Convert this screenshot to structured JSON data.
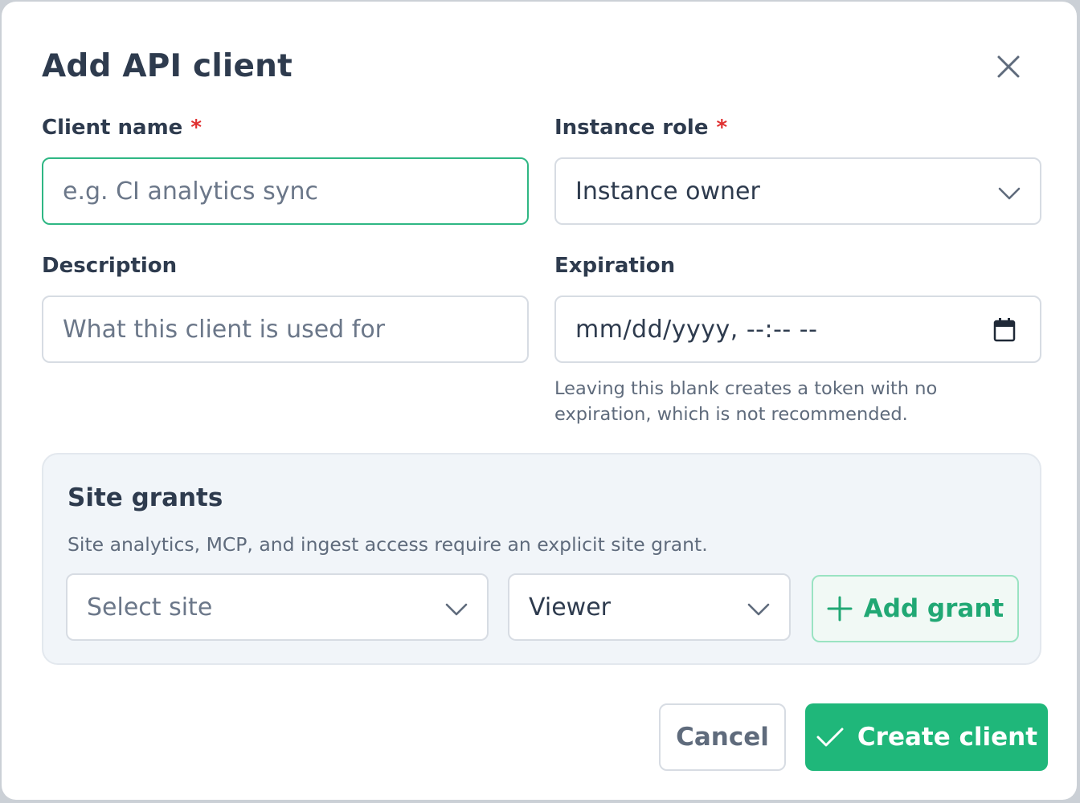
{
  "dialog": {
    "title": "Add API client"
  },
  "form": {
    "client_name": {
      "label": "Client name",
      "required_mark": "*",
      "placeholder": "e.g. CI analytics sync",
      "value": ""
    },
    "instance_role": {
      "label": "Instance role",
      "required_mark": "*",
      "value": "Instance owner"
    },
    "description": {
      "label": "Description",
      "placeholder": "What this client is used for",
      "value": ""
    },
    "expiration": {
      "label": "Expiration",
      "placeholder": "mm/dd/yyyy, --:-- --",
      "help": "Leaving this blank creates a token with no expiration, which is not recommended."
    }
  },
  "site_grants": {
    "title": "Site grants",
    "subtitle": "Site analytics, MCP, and ingest access require an explicit site grant.",
    "site_select": {
      "placeholder": "Select site"
    },
    "role_select": {
      "value": "Viewer"
    },
    "add_label": "Add grant"
  },
  "footer": {
    "cancel_label": "Cancel",
    "create_label": "Create client"
  },
  "icons": [
    "close-icon",
    "chevron-down-icon",
    "calendar-icon",
    "plus-icon",
    "check-icon"
  ],
  "colors": {
    "accent": "#1fb77a",
    "focus_border": "#2fb784",
    "required": "#e03131",
    "panel_bg": "#f1f5f9"
  }
}
